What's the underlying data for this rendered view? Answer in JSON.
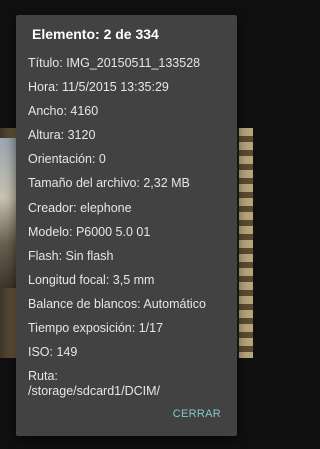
{
  "dialog": {
    "title": "Elemento: 2 de 334",
    "rows": [
      "Título: IMG_20150511_133528",
      "Hora: 11/5/2015 13:35:29",
      "Ancho: 4160",
      "Altura: 3120",
      "Orientación: 0",
      "Tamaño del archivo: 2,32 MB",
      "Creador: elephone",
      "Modelo: P6000 5.0 01",
      "Flash: Sin flash",
      "Longitud focal: 3,5 mm",
      "Balance de blancos: Automático",
      "Tiempo exposición: 1/17",
      "ISO: 149"
    ],
    "path_label": "Ruta:",
    "path_value": "/storage/sdcard1/DCIM/",
    "close_label": "CERRAR"
  }
}
